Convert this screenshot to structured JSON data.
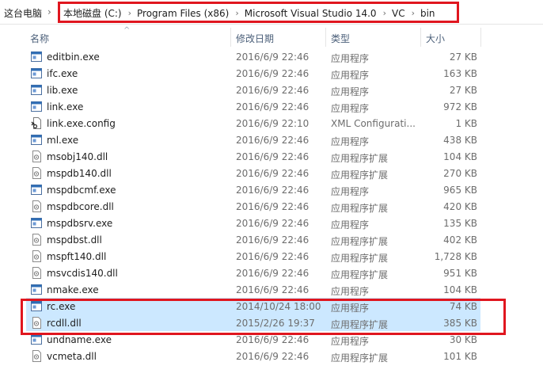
{
  "address": {
    "root": "这台电脑",
    "crumbs": [
      "本地磁盘 (C:)",
      "Program Files (x86)",
      "Microsoft Visual Studio 14.0",
      "VC",
      "bin"
    ],
    "separator": "›"
  },
  "columns": {
    "name": "名称",
    "date": "修改日期",
    "type": "类型",
    "size": "大小"
  },
  "files": [
    {
      "name": "editbin.exe",
      "date": "2016/6/9 22:46",
      "type": "应用程序",
      "size": "27 KB",
      "icon": "exe-icon"
    },
    {
      "name": "ifc.exe",
      "date": "2016/6/9 22:46",
      "type": "应用程序",
      "size": "163 KB",
      "icon": "exe-icon"
    },
    {
      "name": "lib.exe",
      "date": "2016/6/9 22:46",
      "type": "应用程序",
      "size": "27 KB",
      "icon": "exe-icon"
    },
    {
      "name": "link.exe",
      "date": "2016/6/9 22:46",
      "type": "应用程序",
      "size": "972 KB",
      "icon": "exe-icon"
    },
    {
      "name": "link.exe.config",
      "date": "2016/6/9 22:10",
      "type": "XML Configurati...",
      "size": "1 KB",
      "icon": "config-icon"
    },
    {
      "name": "ml.exe",
      "date": "2016/6/9 22:46",
      "type": "应用程序",
      "size": "438 KB",
      "icon": "exe-icon"
    },
    {
      "name": "msobj140.dll",
      "date": "2016/6/9 22:46",
      "type": "应用程序扩展",
      "size": "104 KB",
      "icon": "dll-icon"
    },
    {
      "name": "mspdb140.dll",
      "date": "2016/6/9 22:46",
      "type": "应用程序扩展",
      "size": "270 KB",
      "icon": "dll-icon"
    },
    {
      "name": "mspdbcmf.exe",
      "date": "2016/6/9 22:46",
      "type": "应用程序",
      "size": "965 KB",
      "icon": "exe-icon"
    },
    {
      "name": "mspdbcore.dll",
      "date": "2016/6/9 22:46",
      "type": "应用程序扩展",
      "size": "420 KB",
      "icon": "dll-icon"
    },
    {
      "name": "mspdbsrv.exe",
      "date": "2016/6/9 22:46",
      "type": "应用程序",
      "size": "135 KB",
      "icon": "exe-icon"
    },
    {
      "name": "mspdbst.dll",
      "date": "2016/6/9 22:46",
      "type": "应用程序扩展",
      "size": "402 KB",
      "icon": "dll-icon"
    },
    {
      "name": "mspft140.dll",
      "date": "2016/6/9 22:46",
      "type": "应用程序扩展",
      "size": "1,728 KB",
      "icon": "dll-icon"
    },
    {
      "name": "msvcdis140.dll",
      "date": "2016/6/9 22:46",
      "type": "应用程序扩展",
      "size": "951 KB",
      "icon": "dll-icon"
    },
    {
      "name": "nmake.exe",
      "date": "2016/6/9 22:46",
      "type": "应用程序",
      "size": "104 KB",
      "icon": "exe-icon"
    },
    {
      "name": "rc.exe",
      "date": "2014/10/24 18:00",
      "type": "应用程序",
      "size": "74 KB",
      "icon": "exe-icon",
      "selected": true
    },
    {
      "name": "rcdll.dll",
      "date": "2015/2/26 19:37",
      "type": "应用程序扩展",
      "size": "385 KB",
      "icon": "dll-icon",
      "selected": true
    },
    {
      "name": "undname.exe",
      "date": "2016/6/9 22:46",
      "type": "应用程序",
      "size": "30 KB",
      "icon": "exe-icon"
    },
    {
      "name": "vcmeta.dll",
      "date": "2016/6/9 22:46",
      "type": "应用程序扩展",
      "size": "101 KB",
      "icon": "dll-icon"
    }
  ],
  "colors": {
    "highlight": "#e0161f",
    "selection": "#cce8ff",
    "header_text": "#4c607a"
  }
}
